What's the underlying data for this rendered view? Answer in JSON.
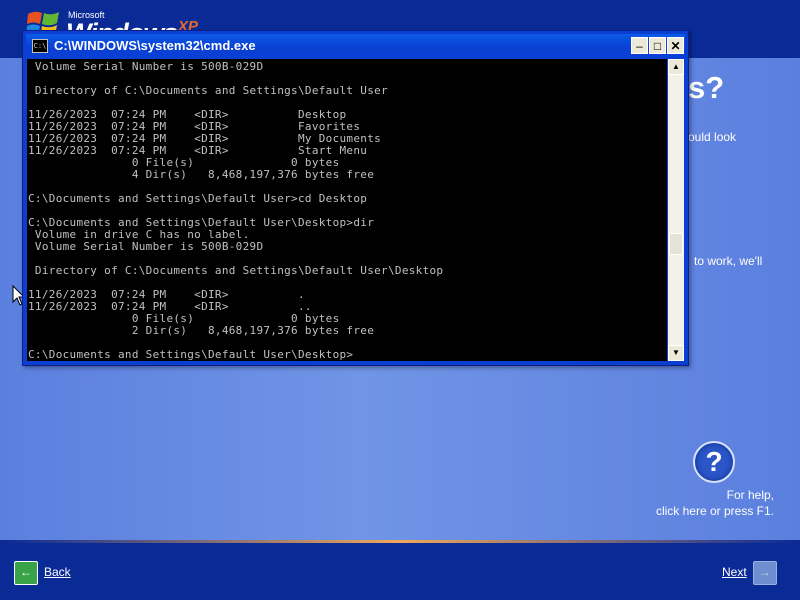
{
  "logo": {
    "microsoft": "Microsoft",
    "windows": "Windows",
    "xp": "XP"
  },
  "background": {
    "heading_partial": "s?",
    "body_partial_1": "ould look",
    "body_partial_2": "to work, we'll"
  },
  "help": {
    "icon_glyph": "?",
    "line1": "For help,",
    "line2": "click here or press F1."
  },
  "nav": {
    "back_label": "Back",
    "next_label": "Next"
  },
  "cmd": {
    "title": "C:\\WINDOWS\\system32\\cmd.exe",
    "lines": [
      " Volume Serial Number is 500B-029D",
      "",
      " Directory of C:\\Documents and Settings\\Default User",
      "",
      "11/26/2023  07:24 PM    <DIR>          Desktop",
      "11/26/2023  07:24 PM    <DIR>          Favorites",
      "11/26/2023  07:24 PM    <DIR>          My Documents",
      "11/26/2023  07:24 PM    <DIR>          Start Menu",
      "               0 File(s)              0 bytes",
      "               4 Dir(s)   8,468,197,376 bytes free",
      "",
      "C:\\Documents and Settings\\Default User>cd Desktop",
      "",
      "C:\\Documents and Settings\\Default User\\Desktop>dir",
      " Volume in drive C has no label.",
      " Volume Serial Number is 500B-029D",
      "",
      " Directory of C:\\Documents and Settings\\Default User\\Desktop",
      "",
      "11/26/2023  07:24 PM    <DIR>          .",
      "11/26/2023  07:24 PM    <DIR>          ..",
      "               0 File(s)              0 bytes",
      "               2 Dir(s)   8,468,197,376 bytes free",
      "",
      "C:\\Documents and Settings\\Default User\\Desktop>"
    ]
  },
  "colors": {
    "oobe_dark_blue": "#0a2a96",
    "oobe_main_blue": "#5b7fde",
    "titlebar_blue": "#0a3fd0",
    "console_bg": "#000000",
    "console_text": "#c0c0c0"
  }
}
